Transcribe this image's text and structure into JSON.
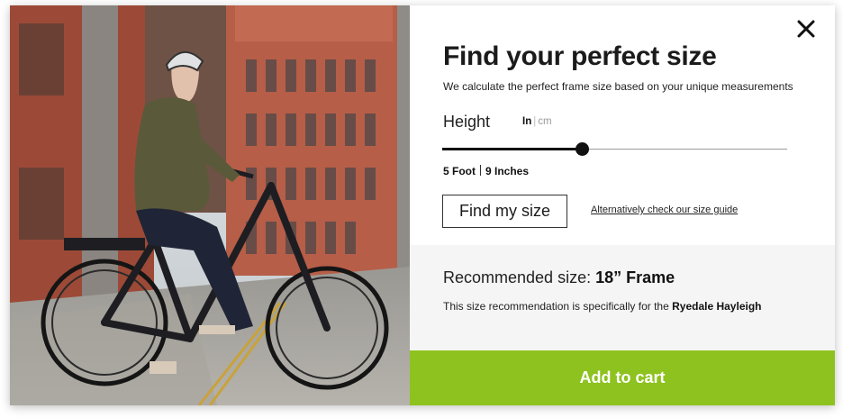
{
  "modal": {
    "title": "Find your perfect size",
    "subtitle": "We calculate the perfect frame size based on your unique measurements",
    "close_icon": "close-icon"
  },
  "height": {
    "label": "Height",
    "unit_active": "In",
    "unit_separator": "|",
    "unit_inactive": "cm",
    "slider_fraction": 0.405,
    "feet": "5 Foot",
    "inches": "9 Inches"
  },
  "actions": {
    "find_label": "Find my size",
    "guide_link": "Alternatively check our size guide",
    "cart_label": "Add to cart"
  },
  "recommendation": {
    "prefix": "Recommended size: ",
    "value": "18” Frame",
    "note_prefix": "This size recommendation is specifically for the ",
    "model": "Ryedale Hayleigh"
  },
  "colors": {
    "cart_green": "#8ec21f",
    "recommendation_bg": "#f5f5f5",
    "text_dark": "#1b1b1b"
  }
}
